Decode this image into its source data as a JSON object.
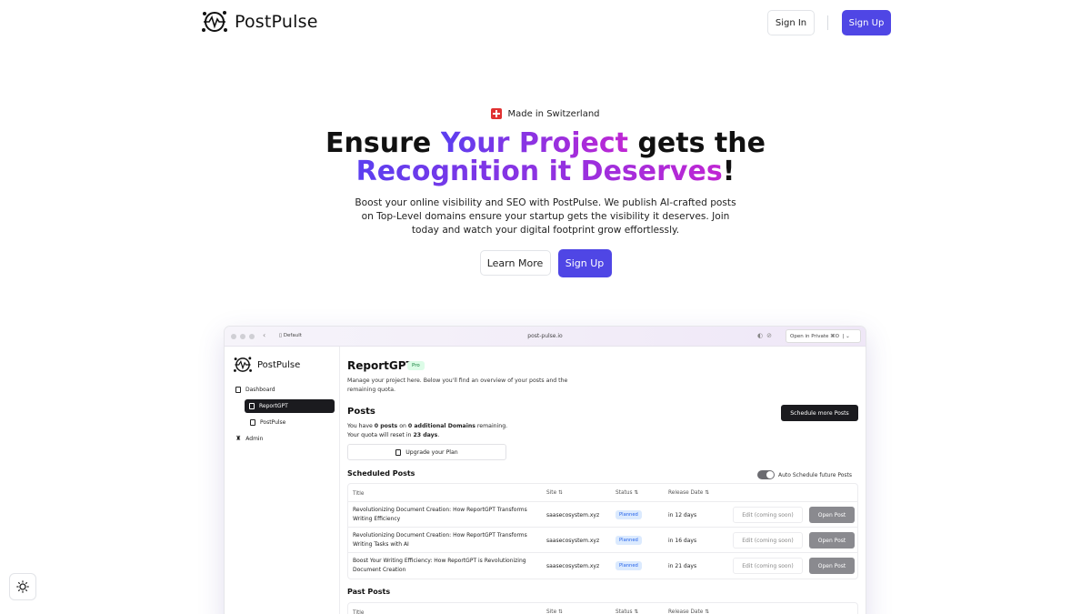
{
  "header": {
    "brand": "PostPulse",
    "signin_label": "Sign In",
    "signup_label": "Sign Up"
  },
  "hero": {
    "badge": "Made in Switzerland",
    "title_part1": "Ensure ",
    "title_highlight1": "Your Project",
    "title_part2": " gets the",
    "title_highlight2": "Recognition it Deserves",
    "title_part3": "!",
    "description": "Boost your online visibility and SEO with PostPulse. We publish AI-crafted posts on Top-Level domains ensure your startup gets the visibility it deserves. Join today and watch your digital footprint grow effortlessly.",
    "learn_more_label": "Learn More",
    "signup_label": "Sign Up"
  },
  "colors": {
    "accent": "#4f46e5",
    "gradient_start": "#5b3ff0",
    "gradient_end": "#c026d3"
  },
  "mockup": {
    "browser": {
      "tab": "Default",
      "url": "post-pulse.io",
      "private_label": "Open in Private",
      "shortcut": "⌘O"
    },
    "sidebar": {
      "brand": "PostPulse",
      "items": [
        {
          "label": "Dashboard"
        },
        {
          "label": "ReportGPT"
        },
        {
          "label": "PostPulse"
        },
        {
          "label": "Admin"
        }
      ]
    },
    "main": {
      "project_title": "ReportGPT",
      "plan_badge": "Pro",
      "description": "Manage your project here. Below you'll find an overview of your posts and the remaining quota.",
      "posts_title": "Posts",
      "quota_prefix": "You have ",
      "quota_posts": "0 posts",
      "quota_middle": " on ",
      "quota_domains": "0 additional Domains",
      "quota_suffix": " remaining.",
      "reset_prefix": "Your quota will reset in ",
      "reset_days": "23 days",
      "reset_suffix": ".",
      "schedule_button": "Schedule more Posts",
      "upgrade_button": "Upgrade your Plan",
      "scheduled_title": "Scheduled Posts",
      "auto_schedule_label": "Auto Schedule future Posts",
      "columns": {
        "title": "Title",
        "site": "Site",
        "status": "Status",
        "release": "Release Date"
      },
      "rows": [
        {
          "title": "Revolutionizing Document Creation: How ReportGPT Transforms Writing Efficiency",
          "site": "saasecosystem.xyz",
          "status": "Planned",
          "release": "in 12 days",
          "edit": "Edit (coming soon)",
          "open": "Open Post"
        },
        {
          "title": "Revolutionizing Document Creation: How ReportGPT Transforms Writing Tasks with AI",
          "site": "saasecosystem.xyz",
          "status": "Planned",
          "release": "in 16 days",
          "edit": "Edit (coming soon)",
          "open": "Open Post"
        },
        {
          "title": "Boost Your Writing Efficiency: How ReportGPT is Revolutionizing Document Creation",
          "site": "saasecosystem.xyz",
          "status": "Planned",
          "release": "in 21 days",
          "edit": "Edit (coming soon)",
          "open": "Open Post"
        }
      ],
      "past_title": "Past Posts"
    }
  },
  "theme_toggle_icon": "sun-icon"
}
